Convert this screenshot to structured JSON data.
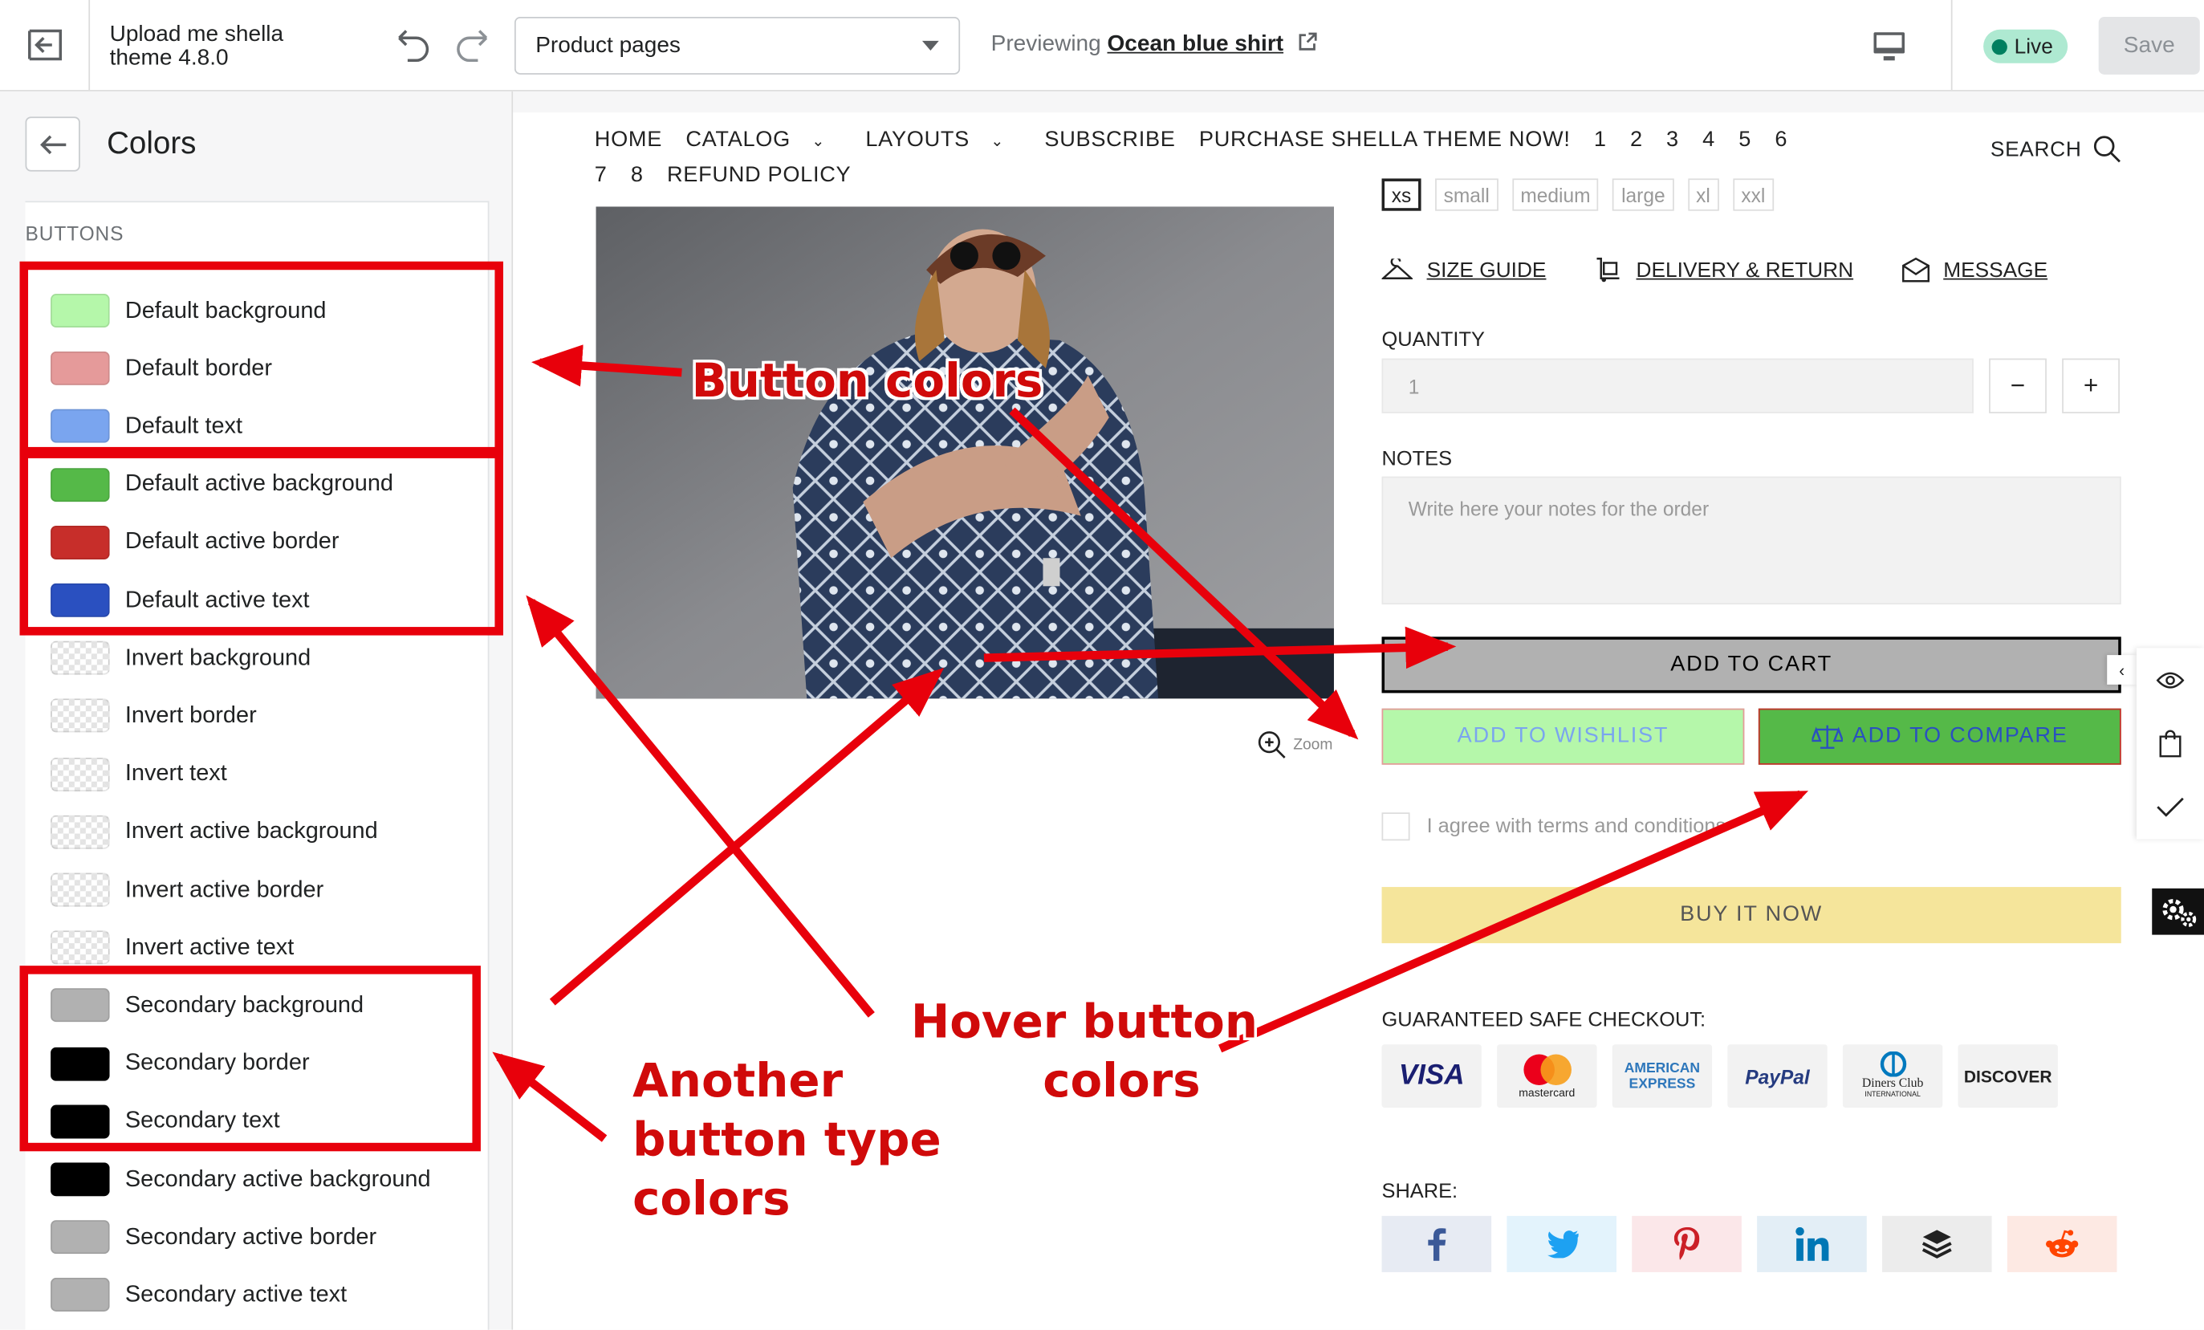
{
  "topbar": {
    "theme_name_line1": "Upload me shella",
    "theme_name_line2": "theme 4.8.0",
    "page_select_value": "Product pages",
    "preview_prefix": "Previewing ",
    "preview_product": "Ocean blue shirt",
    "live_label": "Live",
    "save_label": "Save"
  },
  "sidebar": {
    "title": "Colors",
    "section_label": "BUTTONS",
    "items": [
      {
        "label": "Default background",
        "color": "#b5f7aa"
      },
      {
        "label": "Default border",
        "color": "#e59a9a"
      },
      {
        "label": "Default text",
        "color": "#7aa5ef"
      },
      {
        "label": "Default active background",
        "color": "#55b948"
      },
      {
        "label": "Default active border",
        "color": "#c72e2a"
      },
      {
        "label": "Default active text",
        "color": "#2a50c0"
      },
      {
        "label": "Invert background",
        "color": "transparent"
      },
      {
        "label": "Invert border",
        "color": "transparent"
      },
      {
        "label": "Invert text",
        "color": "transparent"
      },
      {
        "label": "Invert active background",
        "color": "transparent"
      },
      {
        "label": "Invert active border",
        "color": "transparent"
      },
      {
        "label": "Invert active text",
        "color": "transparent"
      },
      {
        "label": "Secondary background",
        "color": "#b1b1b1"
      },
      {
        "label": "Secondary border",
        "color": "#000000"
      },
      {
        "label": "Secondary text",
        "color": "#000000"
      },
      {
        "label": "Secondary active background",
        "color": "#000000"
      },
      {
        "label": "Secondary active border",
        "color": "#b1b1b1"
      },
      {
        "label": "Secondary active text",
        "color": "#b1b1b1"
      }
    ]
  },
  "store": {
    "nav": [
      "HOME",
      "CATALOG",
      "LAYOUTS",
      "SUBSCRIBE",
      "PURCHASE SHELLA THEME NOW!",
      "1",
      "2",
      "3",
      "4",
      "5",
      "6",
      "7",
      "8",
      "REFUND POLICY"
    ],
    "search_label": "SEARCH",
    "zoom_label": "Zoom",
    "sizes": [
      "xs",
      "small",
      "medium",
      "large",
      "xl",
      "xxl"
    ],
    "links": {
      "size_guide": "SIZE GUIDE",
      "delivery": "DELIVERY & RETURN",
      "message": "MESSAGE"
    },
    "quantity_label": "QUANTITY",
    "quantity_value": "1",
    "notes_label": "NOTES",
    "notes_placeholder": "Write here your notes for the order",
    "add_to_cart": "ADD TO CART",
    "add_to_wishlist": "ADD TO WISHLIST",
    "add_to_compare": "ADD TO COMPARE",
    "agree_text": "I agree with terms and conditions",
    "buy_now": "BUY IT NOW",
    "checkout_label": "GUARANTEED SAFE CHECKOUT:",
    "payments": {
      "visa": "VISA",
      "mastercard": "mastercard",
      "amex1": "AMERICAN",
      "amex2": "EXPRESS",
      "paypal": "PayPal",
      "diners": "Diners Club",
      "diners_sub": "INTERNATIONAL",
      "discover": "DISCOVER"
    },
    "share_label": "SHARE:"
  },
  "annotations": {
    "button_colors": "Button colors",
    "another_1": "Another",
    "another_2": "button type",
    "another_3": "colors",
    "hover_1": "Hover button",
    "hover_2": "colors"
  }
}
